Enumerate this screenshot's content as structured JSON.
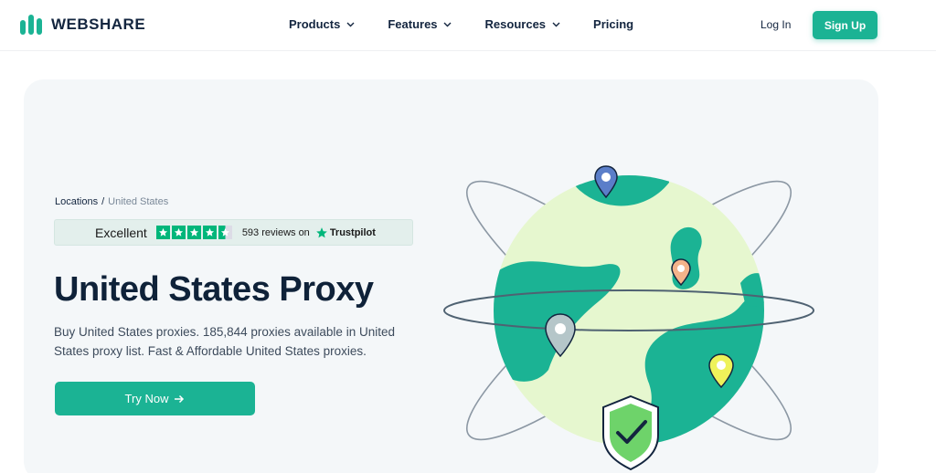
{
  "brand": {
    "name": "WEBSHARE"
  },
  "nav": {
    "items": [
      {
        "label": "Products",
        "has_dropdown": true
      },
      {
        "label": "Features",
        "has_dropdown": true
      },
      {
        "label": "Resources",
        "has_dropdown": true
      },
      {
        "label": "Pricing",
        "has_dropdown": false
      }
    ],
    "login_label": "Log In",
    "signup_label": "Sign Up"
  },
  "hero": {
    "breadcrumb": {
      "root": "Locations",
      "separator": "/",
      "current": "United States"
    },
    "trustpilot": {
      "rating_label": "Excellent",
      "stars": 4.5,
      "reviews_text": "593 reviews on",
      "brand": "Trustpilot"
    },
    "title": "United States Proxy",
    "description": "Buy United States proxies. 185,844 proxies available in United States proxy list. Fast & Affordable United States proxies.",
    "cta_label": "Try Now",
    "illustration_icons": [
      "globe-icon",
      "map-pin-icon",
      "shield-check-icon"
    ]
  },
  "colors": {
    "accent": "#1bb394",
    "dark_text": "#0f2239",
    "globe_light": "#e6f7cf",
    "globe_dark": "#1bb394",
    "trustpilot_green": "#00b67a"
  }
}
